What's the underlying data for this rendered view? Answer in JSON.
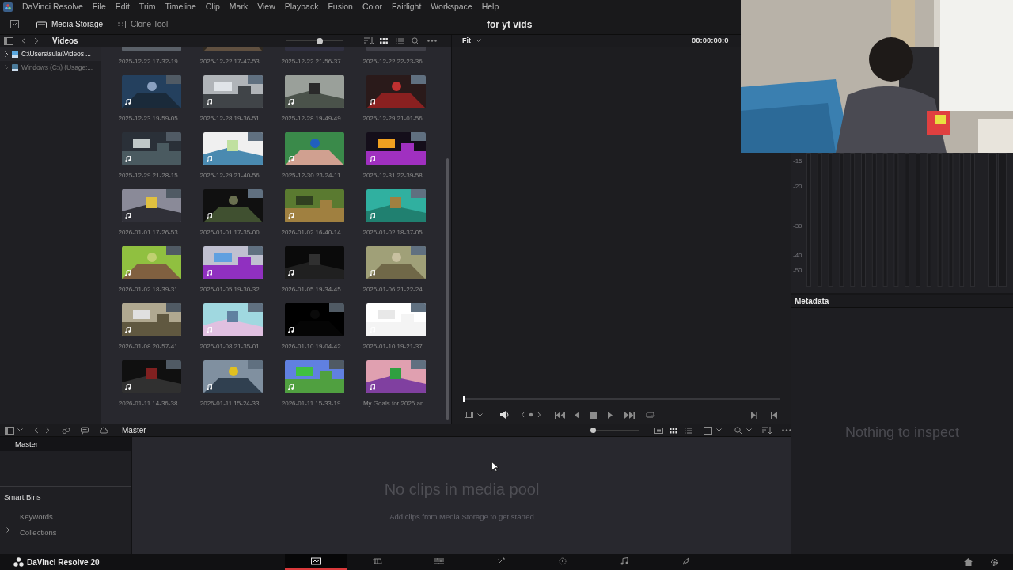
{
  "menu": [
    "DaVinci Resolve",
    "File",
    "Edit",
    "Trim",
    "Timeline",
    "Clip",
    "Mark",
    "View",
    "Playback",
    "Fusion",
    "Color",
    "Fairlight",
    "Workspace",
    "Help"
  ],
  "toolbar": {
    "buttons": [
      {
        "label": "Media Storage",
        "kind": "storage",
        "selected": true
      },
      {
        "label": "Clone Tool",
        "kind": "clone",
        "selected": false
      }
    ],
    "project_title": "for yt vids"
  },
  "storage": {
    "title": "Videos",
    "zoom": {
      "level": 0.6
    },
    "locations": [
      {
        "label": "C:\\Users\\sulai\\Videos ...",
        "selected": true
      },
      {
        "label": "Windows (C:\\) (Usage:...",
        "selected": false
      }
    ],
    "clips": [
      {
        "label": "2025-12-22 17-32-19...."
      },
      {
        "label": "2025-12-22 17-47-53...."
      },
      {
        "label": "2025-12-22 21-56-37...."
      },
      {
        "label": "2025-12-22 22-23-36...."
      },
      {
        "label": "2025-12-23 19-59-05...."
      },
      {
        "label": "2025-12-28 19-36-51...."
      },
      {
        "label": "2025-12-28 19-49-49...."
      },
      {
        "label": "2025-12-29 21-01-56...."
      },
      {
        "label": "2025-12-29 21-28-15...."
      },
      {
        "label": "2025-12-29 21-40-56...."
      },
      {
        "label": "2025-12-30 23-24-11...."
      },
      {
        "label": "2025-12-31 22-39-58...."
      },
      {
        "label": "2026-01-01 17-26-53...."
      },
      {
        "label": "2026-01-01 17-35-00...."
      },
      {
        "label": "2026-01-02 16-40-14...."
      },
      {
        "label": "2026-01-02 18-37-05...."
      },
      {
        "label": "2026-01-02 18-39-31...."
      },
      {
        "label": "2026-01-05 19-30-32...."
      },
      {
        "label": "2026-01-05 19-34-45...."
      },
      {
        "label": "2026-01-06 21-22-24...."
      },
      {
        "label": "2026-01-08 20-57-41...."
      },
      {
        "label": "2026-01-08 21-35-01...."
      },
      {
        "label": "2026-01-10 19-04-42...."
      },
      {
        "label": "2026-01-10 19-21-37...."
      },
      {
        "label": "2026-01-11 14-36-38...."
      },
      {
        "label": "2026-01-11 15-24-33...."
      },
      {
        "label": "2026-01-11 15-33-19...."
      },
      {
        "label": "My Goals for 2026 an..."
      }
    ]
  },
  "viewer": {
    "fit": "Fit",
    "timecode": "00:00:00:0"
  },
  "media_pool": {
    "breadcrumb": "Master",
    "zoom": {
      "level": 0
    },
    "bins": [
      {
        "label": "Master",
        "selected": true
      }
    ],
    "smart_bins": {
      "title": "Smart Bins",
      "items": [
        {
          "label": "Keywords",
          "has_children": false
        },
        {
          "label": "Collections",
          "has_children": true
        }
      ]
    },
    "empty_title": "No clips in media pool",
    "empty_hint": "Add clips from Media Storage to get started"
  },
  "meters": {
    "scale": [
      "-15",
      "-20",
      "-30",
      "-40",
      "-50"
    ]
  },
  "metadata": {
    "title": "Metadata",
    "empty": "Nothing to inspect"
  },
  "footer": {
    "app": "DaVinci Resolve 20",
    "pages": [
      {
        "kind": "media",
        "selected": true
      },
      {
        "kind": "cut",
        "selected": false
      },
      {
        "kind": "edit",
        "selected": false
      },
      {
        "kind": "fusion",
        "selected": false
      },
      {
        "kind": "color",
        "selected": false
      },
      {
        "kind": "fairlight",
        "selected": false
      },
      {
        "kind": "deliver",
        "selected": false
      }
    ]
  }
}
